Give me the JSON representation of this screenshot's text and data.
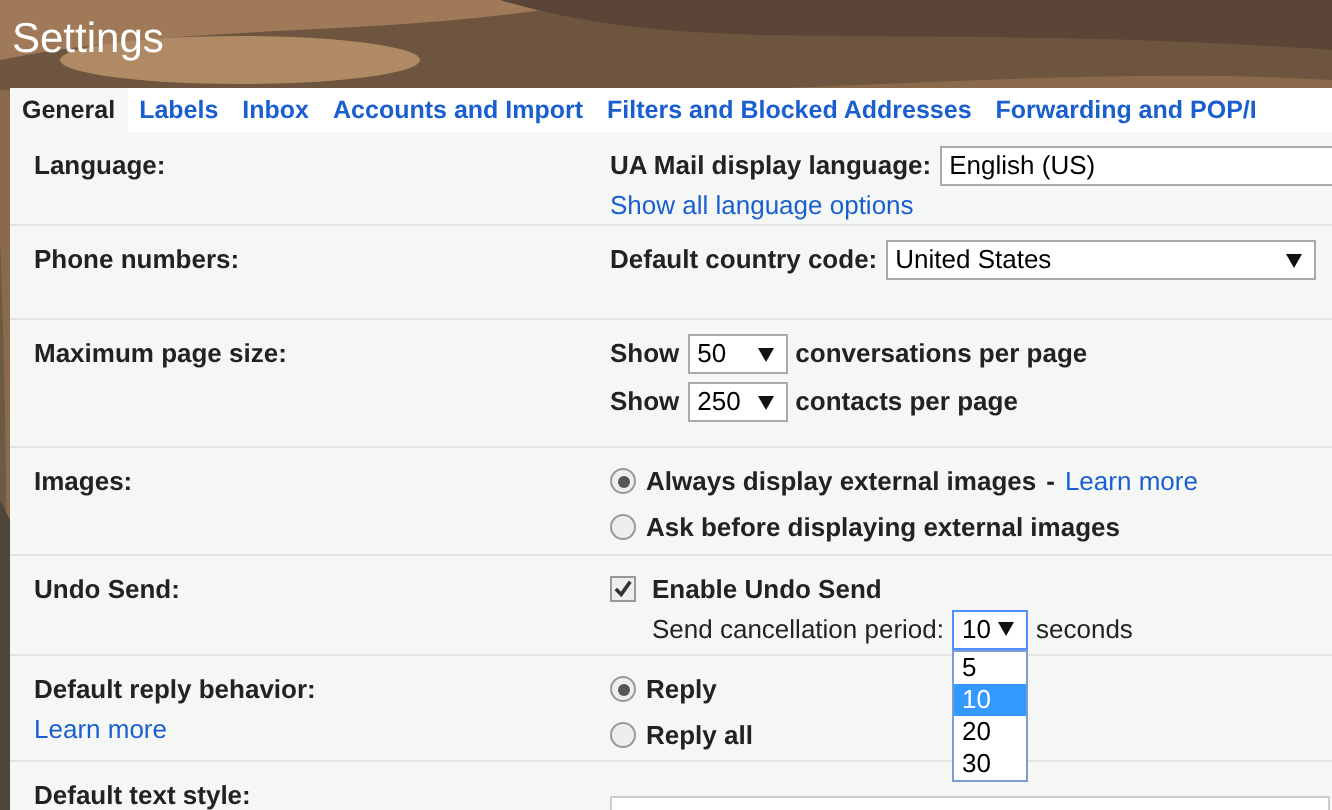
{
  "title": "Settings",
  "tabs": [
    {
      "label": "General",
      "selected": true
    },
    {
      "label": "Labels",
      "selected": false
    },
    {
      "label": "Inbox",
      "selected": false
    },
    {
      "label": "Accounts and Import",
      "selected": false
    },
    {
      "label": "Filters and Blocked Addresses",
      "selected": false
    },
    {
      "label": "Forwarding and POP/I",
      "selected": false
    }
  ],
  "sections": [
    {
      "kind": "select",
      "label": "Language:",
      "field_label": "UA Mail display language:",
      "value": "English (US)",
      "link": "Show all language options"
    },
    {
      "kind": "select",
      "label": "Phone numbers:",
      "field_label": "Default country code:",
      "value": "United States"
    },
    {
      "kind": "page_size",
      "label": "Maximum page size:",
      "rows": [
        {
          "prefix": "Show",
          "value": "50",
          "suffix": "conversations per page"
        },
        {
          "prefix": "Show",
          "value": "250",
          "suffix": "contacts per page"
        }
      ]
    },
    {
      "kind": "radios",
      "label": "Images:",
      "options": [
        {
          "label": "Always display external images",
          "selected": true,
          "separator": "-",
          "link": "Learn more"
        },
        {
          "label": "Ask before displaying external images",
          "selected": false
        }
      ]
    },
    {
      "kind": "undo",
      "label": "Undo Send:",
      "checkbox": {
        "label": "Enable Undo Send",
        "checked": true
      },
      "period_label": "Send cancellation period:",
      "value": "10",
      "suffix": "seconds",
      "options": [
        {
          "label": "5",
          "selected": false
        },
        {
          "label": "10",
          "selected": true
        },
        {
          "label": "20",
          "selected": false
        },
        {
          "label": "30",
          "selected": false
        }
      ]
    },
    {
      "kind": "radios",
      "label": "Default reply behavior:",
      "link": "Learn more",
      "options": [
        {
          "label": "Reply",
          "selected": true
        },
        {
          "label": "Reply all",
          "selected": false
        }
      ]
    },
    {
      "kind": "box",
      "label": "Default text style:"
    }
  ]
}
